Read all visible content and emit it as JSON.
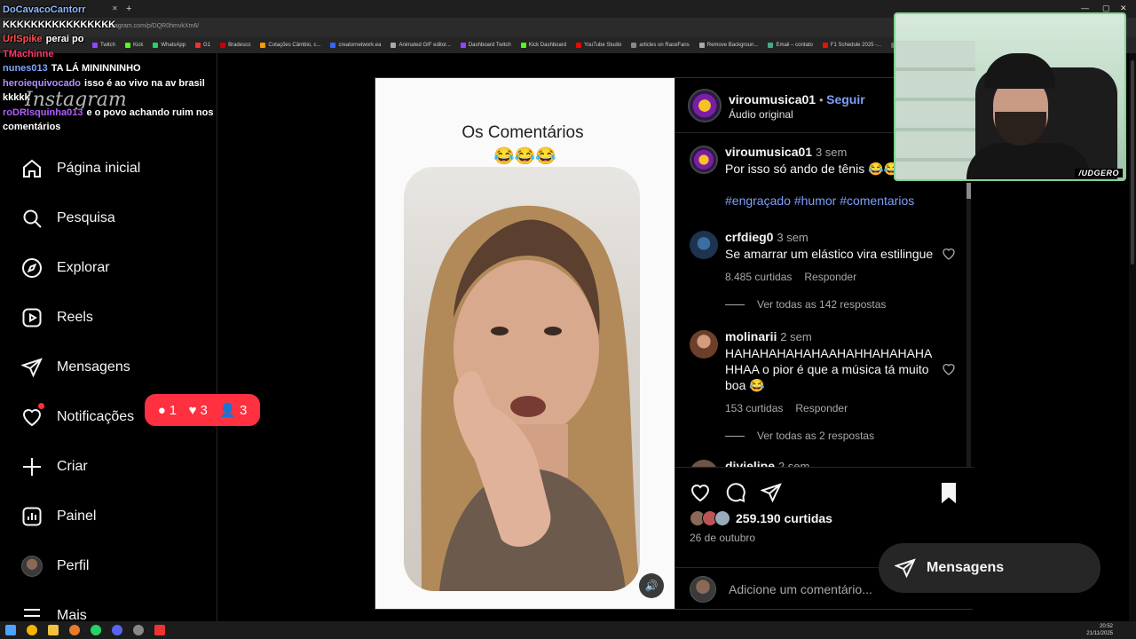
{
  "browser": {
    "url": "instagram.com/p/DQR0hmvkXm6/",
    "bookmarks": [
      "Twitch",
      "Kick",
      "WhatsApp",
      "G1",
      "Bradesco",
      "Cotações Câmbio, c...",
      "creatornetwork.ea",
      "Animated GIF editor...",
      "Dashboard Twitch",
      "Kick Dashboard",
      "YouTube Studio",
      "articles on RaceFans",
      "Remove Backgroun...",
      "Email – contato",
      "F1 Schedule 2025 -...",
      "NFS-"
    ]
  },
  "chat": [
    {
      "user": "DoCavacoCantorr",
      "text": "",
      "color": "#8fb8ff"
    },
    {
      "user": "",
      "text": "KKKKKKKKKKKKKKKK",
      "color": "#ffffff"
    },
    {
      "user": "UrlSpike",
      "text": "perai po",
      "color": "#ff4e4e"
    },
    {
      "user": "TMachinne",
      "text": "",
      "color": "#ff3a6a"
    },
    {
      "user": "nunes013",
      "text": "TA LÁ MININNINHO",
      "color": "#7ea6ff"
    },
    {
      "user": "heroiequivocado",
      "text": "isso é ao vivo na av brasil kkkkk",
      "color": "#b68bff"
    },
    {
      "user": "roDRIsquinha013",
      "text": "e o povo achando ruim nos comentários",
      "color": "#b45cff"
    }
  ],
  "sidebar": {
    "logo": "Instagram",
    "items": [
      {
        "label": "Página inicial",
        "icon": "home-icon"
      },
      {
        "label": "Pesquisa",
        "icon": "search-icon"
      },
      {
        "label": "Explorar",
        "icon": "compass-icon"
      },
      {
        "label": "Reels",
        "icon": "reels-icon"
      },
      {
        "label": "Mensagens",
        "icon": "send-icon"
      },
      {
        "label": "Notificações",
        "icon": "heart-icon"
      },
      {
        "label": "Criar",
        "icon": "plus-icon"
      },
      {
        "label": "Painel",
        "icon": "chart-icon"
      },
      {
        "label": "Perfil",
        "icon": "avatar"
      },
      {
        "label": "Mais",
        "icon": "menu-icon"
      }
    ],
    "notif_popup": {
      "comments": "1",
      "likes": "3",
      "follows": "3"
    }
  },
  "post": {
    "media_title": "Os Comentários",
    "media_emojis": "😂😂😂",
    "author": "viroumusica01",
    "follow": "Seguir",
    "audio": "Áudio original",
    "caption": {
      "user": "viroumusica01",
      "time": "3 sem",
      "text": "Por isso só ando de tênis 😂😂",
      "hashtags": "#engraçado #humor #comentarios"
    },
    "comments": [
      {
        "user": "crfdieg0",
        "time": "3 sem",
        "text": "Se amarrar um elástico vira estilingue",
        "likes": "8.485 curtidas",
        "reply": "Responder",
        "view_replies": "Ver todas as 142 respostas"
      },
      {
        "user": "molinarii",
        "time": "2 sem",
        "text": "HAHAHAHAHAHAAHAHHAHAHAHA HHAA o pior é que a música tá muito boa 😂",
        "likes": "153 curtidas",
        "reply": "Responder",
        "view_replies": "Ver todas as 2 respostas"
      },
      {
        "user": "divielipe",
        "time": "2 sem",
        "text": "",
        "likes": "",
        "reply": "",
        "view_replies": ""
      }
    ],
    "likes_count": "259.190 curtidas",
    "date": "26 de outubro",
    "add_comment_placeholder": "Adicione um comentário..."
  },
  "floating_messages": "Mensagens",
  "webcam": {
    "tag": "/UDGERO"
  },
  "clock": {
    "time": "20:52",
    "date": "21/11/2025"
  },
  "colors": {
    "accent": "#0095f6",
    "link": "#7e9ff9",
    "notif": "#ff3040"
  }
}
